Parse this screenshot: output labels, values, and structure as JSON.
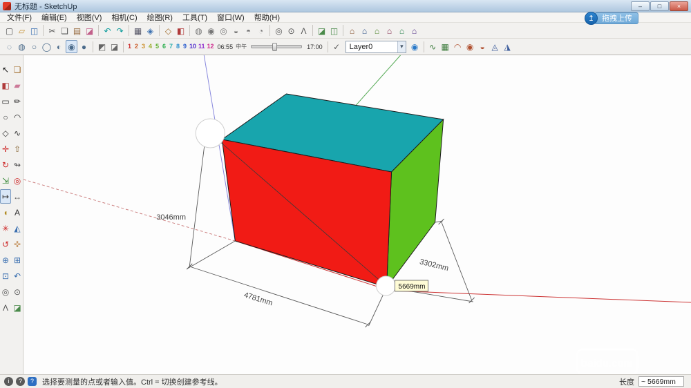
{
  "window": {
    "title": "无标题 - SketchUp",
    "controls": {
      "minimize": "–",
      "maximize": "□",
      "close": "×"
    }
  },
  "overlay": {
    "icon_glyph": "↥",
    "label": "拖拽上传"
  },
  "menu": {
    "items": [
      {
        "name": "menu-file",
        "label": "文件(F)"
      },
      {
        "name": "menu-edit",
        "label": "编辑(E)"
      },
      {
        "name": "menu-view",
        "label": "视图(V)"
      },
      {
        "name": "menu-camera",
        "label": "相机(C)"
      },
      {
        "name": "menu-draw",
        "label": "绘图(R)"
      },
      {
        "name": "menu-tools",
        "label": "工具(T)"
      },
      {
        "name": "menu-window",
        "label": "窗口(W)"
      },
      {
        "name": "menu-help",
        "label": "帮助(H)"
      }
    ]
  },
  "toolbar1": {
    "items": [
      {
        "name": "new-file-button",
        "glyph": "▢",
        "style": "color:#555"
      },
      {
        "name": "open-file-button",
        "glyph": "▱",
        "style": "color:#c8953a"
      },
      {
        "name": "save-button",
        "glyph": "◫",
        "style": "color:#3a6fb0"
      },
      {
        "name": "toolbar-separator",
        "glyph": "",
        "cls": "sep"
      },
      {
        "name": "cut-button",
        "glyph": "✂",
        "style": "color:#555"
      },
      {
        "name": "copy-button",
        "glyph": "❏",
        "style": "color:#555"
      },
      {
        "name": "paste-button",
        "glyph": "▤",
        "style": "color:#96693c"
      },
      {
        "name": "erase-button",
        "glyph": "◪",
        "style": "color:#c2608a"
      },
      {
        "name": "toolbar-separator",
        "glyph": "",
        "cls": "sep"
      },
      {
        "name": "undo-button",
        "glyph": "↶",
        "style": "color:#089a9a"
      },
      {
        "name": "redo-button",
        "glyph": "↷",
        "style": "color:#089a9a"
      },
      {
        "name": "toolbar-separator",
        "glyph": "",
        "cls": "sep"
      },
      {
        "name": "print-button",
        "glyph": "▦",
        "style": "color:#556"
      },
      {
        "name": "model-info-button",
        "glyph": "◈",
        "style": "color:#3a6fb0"
      },
      {
        "name": "toolbar-separator",
        "glyph": "",
        "cls": "sep"
      },
      {
        "name": "make-component-button",
        "glyph": "◇",
        "style": "color:#a06a28"
      },
      {
        "name": "paint-bucket-button",
        "glyph": "◧",
        "style": "color:#b03a3a"
      },
      {
        "name": "toolbar-separator",
        "glyph": "",
        "cls": "sep"
      },
      {
        "name": "solid-outer-shell-button",
        "glyph": "◍",
        "style": "color:#767676"
      },
      {
        "name": "solid-union-button",
        "glyph": "◉",
        "style": "color:#767676"
      },
      {
        "name": "solid-subtract-button",
        "glyph": "◎",
        "style": "color:#767676"
      },
      {
        "name": "solid-trim-button",
        "glyph": "◒",
        "style": "color:#767676"
      },
      {
        "name": "solid-intersect-button",
        "glyph": "◓",
        "style": "color:#767676"
      },
      {
        "name": "solid-split-button",
        "glyph": "◔",
        "style": "color:#767676"
      },
      {
        "name": "toolbar-separator",
        "glyph": "",
        "cls": "sep"
      },
      {
        "name": "position-camera-button",
        "glyph": "◎",
        "style": "color:#555"
      },
      {
        "name": "look-around-button",
        "glyph": "⊙",
        "style": "color:#555"
      },
      {
        "name": "walk-button",
        "glyph": "Λ",
        "style": "color:#555"
      },
      {
        "name": "toolbar-separator",
        "glyph": "",
        "cls": "sep"
      },
      {
        "name": "section-plane-button",
        "glyph": "◪",
        "style": "color:#4a8a4a"
      },
      {
        "name": "section-display-button",
        "glyph": "◫",
        "style": "color:#4a8a4a"
      },
      {
        "name": "toolbar-separator",
        "glyph": "",
        "cls": "sep"
      },
      {
        "name": "iso-view-button",
        "glyph": "⌂",
        "style": "color:#885533"
      },
      {
        "name": "top-view-button",
        "glyph": "⌂",
        "style": "color:#335588"
      },
      {
        "name": "front-view-button",
        "glyph": "⌂",
        "style": "color:#558833"
      },
      {
        "name": "right-view-button",
        "glyph": "⌂",
        "style": "color:#883355"
      },
      {
        "name": "back-view-button",
        "glyph": "⌂",
        "style": "color:#338855"
      },
      {
        "name": "left-view-button",
        "glyph": "⌂",
        "style": "color:#553388"
      }
    ],
    "face_styles": [
      {
        "name": "xray-button",
        "glyph": "◌",
        "style": "color:#4a6a8a"
      },
      {
        "name": "back-edges-button",
        "glyph": "◍",
        "style": "color:#4a6a8a"
      },
      {
        "name": "wireframe-button",
        "glyph": "○",
        "style": "color:#4a6a8a"
      },
      {
        "name": "hidden-line-button",
        "glyph": "◯",
        "style": "color:#4a6a8a"
      },
      {
        "name": "shaded-button",
        "glyph": "◐",
        "style": "color:#4a6a8a"
      },
      {
        "name": "shaded-textures-button",
        "glyph": "◉",
        "style": "color:#4a6a8a",
        "cls": "selected"
      },
      {
        "name": "monochrome-button",
        "glyph": "●",
        "style": "color:#4a6a8a"
      }
    ],
    "shadow_buttons": [
      {
        "name": "shadow-dialog-button",
        "glyph": "◩",
        "style": "color:#666"
      },
      {
        "name": "shadow-toggle-button",
        "glyph": "◪",
        "style": "color:#666"
      }
    ],
    "months": [
      {
        "name": "shadow-month-1",
        "glyph": "1",
        "style": "color:#cc2b2b"
      },
      {
        "name": "shadow-month-2",
        "glyph": "2",
        "style": "color:#cc5d2b"
      },
      {
        "name": "shadow-month-3",
        "glyph": "3",
        "style": "color:#cc8f2b"
      },
      {
        "name": "shadow-month-4",
        "glyph": "4",
        "style": "color:#9bae2b"
      },
      {
        "name": "shadow-month-5",
        "glyph": "5",
        "style": "color:#5bae2b"
      },
      {
        "name": "shadow-month-6",
        "glyph": "6",
        "style": "color:#2bae4e"
      },
      {
        "name": "shadow-month-7",
        "glyph": "7",
        "style": "color:#2baeae"
      },
      {
        "name": "shadow-month-8",
        "glyph": "8",
        "style": "color:#2b8fce"
      },
      {
        "name": "shadow-month-9",
        "glyph": "9",
        "style": "color:#2b5dce"
      },
      {
        "name": "shadow-month-10",
        "glyph": "10",
        "style": "color:#4e2bce"
      },
      {
        "name": "shadow-month-11",
        "glyph": "11",
        "style": "color:#8f2bce"
      },
      {
        "name": "shadow-month-12",
        "glyph": "12",
        "style": "color:#ce2b8f"
      }
    ],
    "sandbox": [
      {
        "name": "sandbox-from-contours-button",
        "glyph": "∿",
        "style": "color:#3a7a3a"
      },
      {
        "name": "sandbox-from-scratch-button",
        "glyph": "▦",
        "style": "color:#3a7a3a"
      },
      {
        "name": "sandbox-smoove-button",
        "glyph": "◠",
        "style": "color:#b05030"
      },
      {
        "name": "sandbox-stamp-button",
        "glyph": "◉",
        "style": "color:#b05030"
      },
      {
        "name": "sandbox-drape-button",
        "glyph": "◒",
        "style": "color:#b05030"
      },
      {
        "name": "sandbox-add-detail-button",
        "glyph": "◬",
        "style": "color:#3a5a9a"
      },
      {
        "name": "sandbox-flip-edge-button",
        "glyph": "◮",
        "style": "color:#3a5a9a"
      }
    ]
  },
  "shadow_time": {
    "start_time": "06:55",
    "noon_label": "中午",
    "end_time": "17:00"
  },
  "layers": {
    "check_glyph": "✓",
    "active_layer": "Layer0",
    "dropdown_glyph": "▾",
    "manager_glyph": "◉"
  },
  "left_toolbar": {
    "items": [
      {
        "name": "select-tool",
        "glyph": "↖",
        "style": "color:#111"
      },
      {
        "name": "make-component-tool",
        "glyph": "❏",
        "style": "color:#a06a28"
      },
      {
        "name": "paint-bucket-tool",
        "glyph": "◧",
        "style": "color:#b03a3a"
      },
      {
        "name": "eraser-tool",
        "glyph": "▰",
        "style": "color:#cc7a99"
      },
      {
        "name": "rectangle-tool",
        "glyph": "▭",
        "style": "color:#333"
      },
      {
        "name": "line-tool",
        "glyph": "✏",
        "style": "color:#333"
      },
      {
        "name": "circle-tool",
        "glyph": "○",
        "style": "color:#333"
      },
      {
        "name": "arc-tool",
        "glyph": "◠",
        "style": "color:#333"
      },
      {
        "name": "polygon-tool",
        "glyph": "◇",
        "style": "color:#333"
      },
      {
        "name": "freehand-tool",
        "glyph": "∿",
        "style": "color:#333"
      },
      {
        "name": "move-tool",
        "glyph": "✛",
        "style": "color:#cc2222"
      },
      {
        "name": "push-pull-tool",
        "glyph": "⇧",
        "style": "color:#8a6a3a"
      },
      {
        "name": "rotate-tool",
        "glyph": "↻",
        "style": "color:#cc2222"
      },
      {
        "name": "follow-me-tool",
        "glyph": "↬",
        "style": "color:#555"
      },
      {
        "name": "scale-tool",
        "glyph": "⇲",
        "style": "color:#3a8a3a"
      },
      {
        "name": "offset-tool",
        "glyph": "◎",
        "style": "color:#cc2222"
      },
      {
        "name": "tape-measure-tool",
        "glyph": "↦",
        "style": "color:#333",
        "cls": "selected"
      },
      {
        "name": "dimension-tool",
        "glyph": "↔",
        "style": "color:#555"
      },
      {
        "name": "protractor-tool",
        "glyph": "◖",
        "style": "color:#b08a20"
      },
      {
        "name": "text-tool",
        "glyph": "A",
        "style": "color:#333"
      },
      {
        "name": "axes-tool",
        "glyph": "✳",
        "style": "color:#cc2222"
      },
      {
        "name": "3d-text-tool",
        "glyph": "◭",
        "style": "color:#3a6fb0"
      },
      {
        "name": "orbit-tool",
        "glyph": "↺",
        "style": "color:#cc2222"
      },
      {
        "name": "pan-tool",
        "glyph": "✜",
        "style": "color:#c89a6a"
      },
      {
        "name": "zoom-tool",
        "glyph": "⊕",
        "style": "color:#3a6fb0"
      },
      {
        "name": "zoom-window-tool",
        "glyph": "⊞",
        "style": "color:#3a6fb0"
      },
      {
        "name": "zoom-extents-tool",
        "glyph": "⊡",
        "style": "color:#3a6fb0"
      },
      {
        "name": "previous-view-tool",
        "glyph": "↶",
        "style": "color:#3a6fb0"
      },
      {
        "name": "position-camera-tool",
        "glyph": "◎",
        "style": "color:#555"
      },
      {
        "name": "look-around-tool",
        "glyph": "⊙",
        "style": "color:#555"
      },
      {
        "name": "walk-tool",
        "glyph": "Λ",
        "style": "color:#555"
      },
      {
        "name": "section-plane-tool",
        "glyph": "◪",
        "style": "color:#4a8a4a"
      }
    ]
  },
  "viewport": {
    "colors": {
      "top": "#18a5ad",
      "front": "#f11b15",
      "right": "#5ec11e"
    },
    "dimensions": {
      "left": "3046mm",
      "bottom": "4781mm",
      "right": "3302mm",
      "tooltip": "5669mm"
    },
    "watermark": {
      "text": "baidu.com"
    }
  },
  "status": {
    "icons": [
      {
        "name": "geolocation-icon",
        "glyph": "i"
      },
      {
        "name": "credits-icon",
        "glyph": "?"
      },
      {
        "name": "help-badge-icon",
        "glyph": "?",
        "cls": "badge"
      }
    ],
    "message": "选择要测量的点或者输入值。Ctrl = 切换创建参考线。",
    "measure_label": "长度",
    "measure_value": "~ 5669mm"
  }
}
